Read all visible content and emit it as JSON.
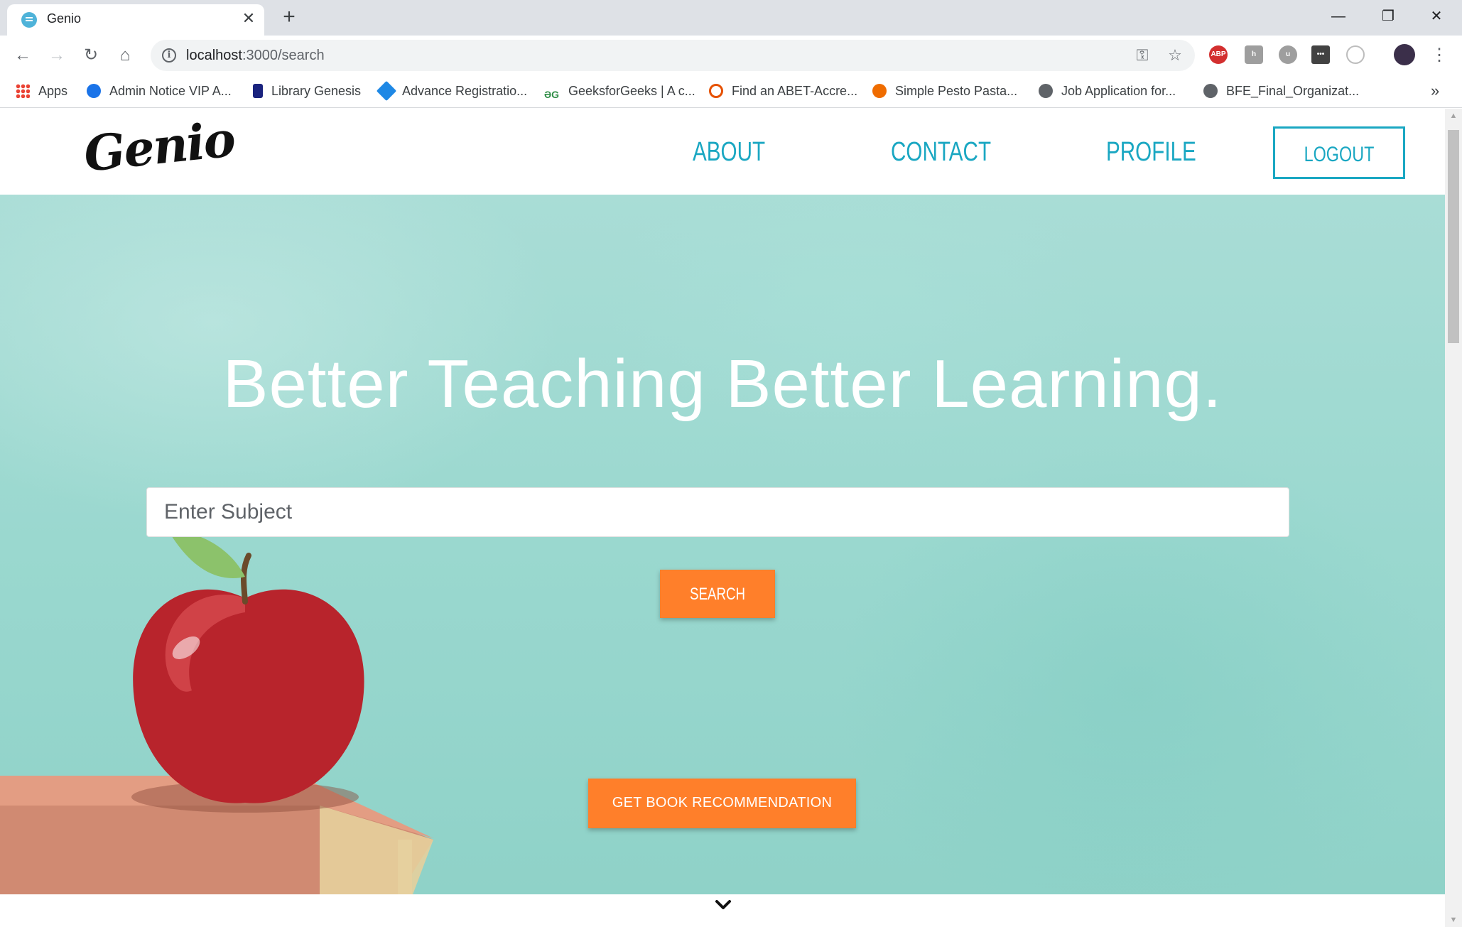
{
  "browser": {
    "tab_title": "Genio",
    "tab_close": "✕",
    "new_tab": "+",
    "url_host": "localhost",
    "url_path": ":3000/search",
    "window_controls": {
      "minimize": "—",
      "restore": "❐",
      "close": "✕"
    }
  },
  "bookmarks": [
    {
      "label": "Apps",
      "icon": "apps-grid-icon",
      "color": "#ea4335"
    },
    {
      "label": "Admin Notice VIP A...",
      "icon": "globe-icon",
      "color": "#1a73e8"
    },
    {
      "label": "Library Genesis",
      "icon": "library-icon",
      "color": "#1a237e"
    },
    {
      "label": "Advance Registratio...",
      "icon": "diamond-icon",
      "color": "#1e88e5"
    },
    {
      "label": "GeeksforGeeks | A c...",
      "icon": "geeks-icon",
      "color": "#2f8d46"
    },
    {
      "label": "Find an ABET-Accre...",
      "icon": "abet-icon",
      "color": "#e65100"
    },
    {
      "label": "Simple Pesto Pasta...",
      "icon": "recipe-icon",
      "color": "#ef6c00"
    },
    {
      "label": "Job Application for...",
      "icon": "globe-icon",
      "color": "#5f6368"
    },
    {
      "label": "BFE_Final_Organizat...",
      "icon": "globe-icon",
      "color": "#5f6368"
    }
  ],
  "bookmarks_overflow": "»",
  "extensions": [
    {
      "name": "adblock-icon",
      "label": "ABP",
      "color": "#d32f2f"
    },
    {
      "name": "extension-h-icon",
      "label": "h",
      "color": "#9e9e9e"
    },
    {
      "name": "extension-u-icon",
      "label": "u",
      "color": "#9e9e9e"
    },
    {
      "name": "extension-dots-icon",
      "label": "•••",
      "color": "#424242"
    },
    {
      "name": "extension-circle-icon",
      "label": "",
      "color": "#e0e0e0"
    }
  ],
  "site": {
    "logo": "Genio",
    "nav": {
      "about": "ABOUT",
      "contact": "CONTACT",
      "profile": "PROFILE",
      "logout": "LOGOUT"
    },
    "accent": "#1aa7c2"
  },
  "hero": {
    "headline": "Better Teaching Better Learning.",
    "search_placeholder": "Enter Subject",
    "search_button": "SEARCH",
    "recommend_button": "GET BOOK RECOMMENDATION",
    "button_color": "#ff7f2a"
  }
}
